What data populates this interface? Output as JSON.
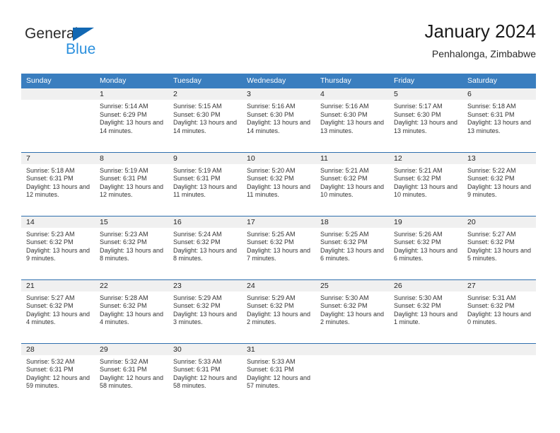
{
  "brand": {
    "name_part1": "General",
    "name_part2": "Blue",
    "flag_icon": "triangle-flag-icon",
    "blue": "#2a8fdd",
    "dark_blue": "#1268b3"
  },
  "header": {
    "title": "January 2024",
    "location": "Penhalonga, Zimbabwe"
  },
  "theme": {
    "header_bg": "#3a7ebf",
    "header_text": "#ffffff",
    "daynum_bg": "#f0f0f0",
    "row_divider": "#2f6fae",
    "body_text": "#333333"
  },
  "weekdays": [
    "Sunday",
    "Monday",
    "Tuesday",
    "Wednesday",
    "Thursday",
    "Friday",
    "Saturday"
  ],
  "weeks": [
    [
      {
        "day": "",
        "sunrise": "",
        "sunset": "",
        "daylight": ""
      },
      {
        "day": "1",
        "sunrise": "Sunrise: 5:14 AM",
        "sunset": "Sunset: 6:29 PM",
        "daylight": "Daylight: 13 hours and 14 minutes."
      },
      {
        "day": "2",
        "sunrise": "Sunrise: 5:15 AM",
        "sunset": "Sunset: 6:30 PM",
        "daylight": "Daylight: 13 hours and 14 minutes."
      },
      {
        "day": "3",
        "sunrise": "Sunrise: 5:16 AM",
        "sunset": "Sunset: 6:30 PM",
        "daylight": "Daylight: 13 hours and 14 minutes."
      },
      {
        "day": "4",
        "sunrise": "Sunrise: 5:16 AM",
        "sunset": "Sunset: 6:30 PM",
        "daylight": "Daylight: 13 hours and 13 minutes."
      },
      {
        "day": "5",
        "sunrise": "Sunrise: 5:17 AM",
        "sunset": "Sunset: 6:30 PM",
        "daylight": "Daylight: 13 hours and 13 minutes."
      },
      {
        "day": "6",
        "sunrise": "Sunrise: 5:18 AM",
        "sunset": "Sunset: 6:31 PM",
        "daylight": "Daylight: 13 hours and 13 minutes."
      }
    ],
    [
      {
        "day": "7",
        "sunrise": "Sunrise: 5:18 AM",
        "sunset": "Sunset: 6:31 PM",
        "daylight": "Daylight: 13 hours and 12 minutes."
      },
      {
        "day": "8",
        "sunrise": "Sunrise: 5:19 AM",
        "sunset": "Sunset: 6:31 PM",
        "daylight": "Daylight: 13 hours and 12 minutes."
      },
      {
        "day": "9",
        "sunrise": "Sunrise: 5:19 AM",
        "sunset": "Sunset: 6:31 PM",
        "daylight": "Daylight: 13 hours and 11 minutes."
      },
      {
        "day": "10",
        "sunrise": "Sunrise: 5:20 AM",
        "sunset": "Sunset: 6:32 PM",
        "daylight": "Daylight: 13 hours and 11 minutes."
      },
      {
        "day": "11",
        "sunrise": "Sunrise: 5:21 AM",
        "sunset": "Sunset: 6:32 PM",
        "daylight": "Daylight: 13 hours and 10 minutes."
      },
      {
        "day": "12",
        "sunrise": "Sunrise: 5:21 AM",
        "sunset": "Sunset: 6:32 PM",
        "daylight": "Daylight: 13 hours and 10 minutes."
      },
      {
        "day": "13",
        "sunrise": "Sunrise: 5:22 AM",
        "sunset": "Sunset: 6:32 PM",
        "daylight": "Daylight: 13 hours and 9 minutes."
      }
    ],
    [
      {
        "day": "14",
        "sunrise": "Sunrise: 5:23 AM",
        "sunset": "Sunset: 6:32 PM",
        "daylight": "Daylight: 13 hours and 9 minutes."
      },
      {
        "day": "15",
        "sunrise": "Sunrise: 5:23 AM",
        "sunset": "Sunset: 6:32 PM",
        "daylight": "Daylight: 13 hours and 8 minutes."
      },
      {
        "day": "16",
        "sunrise": "Sunrise: 5:24 AM",
        "sunset": "Sunset: 6:32 PM",
        "daylight": "Daylight: 13 hours and 8 minutes."
      },
      {
        "day": "17",
        "sunrise": "Sunrise: 5:25 AM",
        "sunset": "Sunset: 6:32 PM",
        "daylight": "Daylight: 13 hours and 7 minutes."
      },
      {
        "day": "18",
        "sunrise": "Sunrise: 5:25 AM",
        "sunset": "Sunset: 6:32 PM",
        "daylight": "Daylight: 13 hours and 6 minutes."
      },
      {
        "day": "19",
        "sunrise": "Sunrise: 5:26 AM",
        "sunset": "Sunset: 6:32 PM",
        "daylight": "Daylight: 13 hours and 6 minutes."
      },
      {
        "day": "20",
        "sunrise": "Sunrise: 5:27 AM",
        "sunset": "Sunset: 6:32 PM",
        "daylight": "Daylight: 13 hours and 5 minutes."
      }
    ],
    [
      {
        "day": "21",
        "sunrise": "Sunrise: 5:27 AM",
        "sunset": "Sunset: 6:32 PM",
        "daylight": "Daylight: 13 hours and 4 minutes."
      },
      {
        "day": "22",
        "sunrise": "Sunrise: 5:28 AM",
        "sunset": "Sunset: 6:32 PM",
        "daylight": "Daylight: 13 hours and 4 minutes."
      },
      {
        "day": "23",
        "sunrise": "Sunrise: 5:29 AM",
        "sunset": "Sunset: 6:32 PM",
        "daylight": "Daylight: 13 hours and 3 minutes."
      },
      {
        "day": "24",
        "sunrise": "Sunrise: 5:29 AM",
        "sunset": "Sunset: 6:32 PM",
        "daylight": "Daylight: 13 hours and 2 minutes."
      },
      {
        "day": "25",
        "sunrise": "Sunrise: 5:30 AM",
        "sunset": "Sunset: 6:32 PM",
        "daylight": "Daylight: 13 hours and 2 minutes."
      },
      {
        "day": "26",
        "sunrise": "Sunrise: 5:30 AM",
        "sunset": "Sunset: 6:32 PM",
        "daylight": "Daylight: 13 hours and 1 minute."
      },
      {
        "day": "27",
        "sunrise": "Sunrise: 5:31 AM",
        "sunset": "Sunset: 6:32 PM",
        "daylight": "Daylight: 13 hours and 0 minutes."
      }
    ],
    [
      {
        "day": "28",
        "sunrise": "Sunrise: 5:32 AM",
        "sunset": "Sunset: 6:31 PM",
        "daylight": "Daylight: 12 hours and 59 minutes."
      },
      {
        "day": "29",
        "sunrise": "Sunrise: 5:32 AM",
        "sunset": "Sunset: 6:31 PM",
        "daylight": "Daylight: 12 hours and 58 minutes."
      },
      {
        "day": "30",
        "sunrise": "Sunrise: 5:33 AM",
        "sunset": "Sunset: 6:31 PM",
        "daylight": "Daylight: 12 hours and 58 minutes."
      },
      {
        "day": "31",
        "sunrise": "Sunrise: 5:33 AM",
        "sunset": "Sunset: 6:31 PM",
        "daylight": "Daylight: 12 hours and 57 minutes."
      },
      {
        "day": "",
        "sunrise": "",
        "sunset": "",
        "daylight": ""
      },
      {
        "day": "",
        "sunrise": "",
        "sunset": "",
        "daylight": ""
      },
      {
        "day": "",
        "sunrise": "",
        "sunset": "",
        "daylight": ""
      }
    ]
  ]
}
